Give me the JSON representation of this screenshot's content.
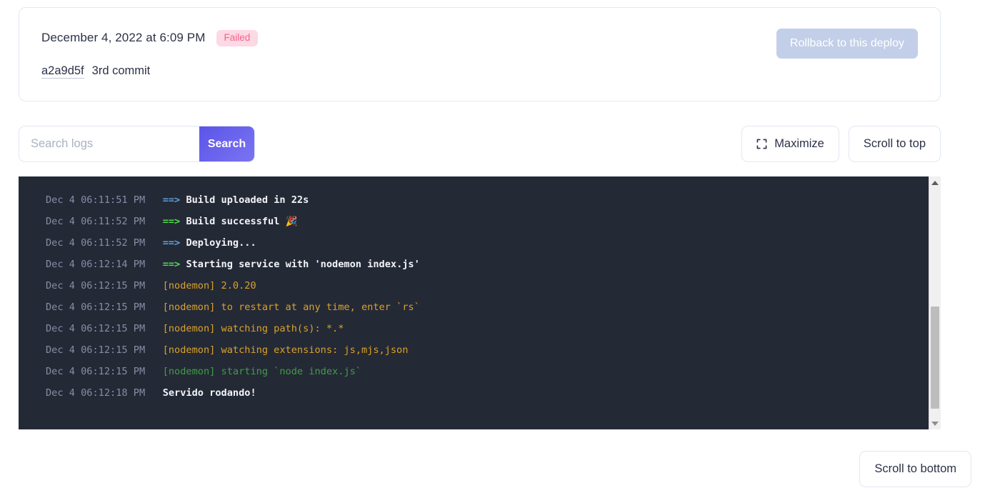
{
  "deploy": {
    "date": "December 4, 2022 at 6:09 PM",
    "status": "Failed",
    "status_bg": "#fcd9e4",
    "status_fg": "#f4648c",
    "commit_hash": "a2a9d5f",
    "commit_message": "3rd commit",
    "rollback_label": "Rollback to this deploy"
  },
  "toolbar": {
    "search_placeholder": "Search logs",
    "search_value": "",
    "search_label": "Search",
    "search_accent": "#5b55e8",
    "maximize_label": "Maximize",
    "maximize_icon": "expand-corners-icon",
    "scroll_top_label": "Scroll to top"
  },
  "console": {
    "background": "#242936",
    "lines": [
      {
        "time": "Dec 4 06:11:51 PM",
        "prefix": "==>",
        "prefix_color": "blue",
        "text": "Build uploaded in 22s",
        "text_color": "white"
      },
      {
        "time": "Dec 4 06:11:52 PM",
        "prefix": "==>",
        "prefix_color": "green",
        "text": "Build successful 🎉",
        "text_color": "white"
      },
      {
        "time": "Dec 4 06:11:52 PM",
        "prefix": "==>",
        "prefix_color": "blue",
        "text": "Deploying...",
        "text_color": "white"
      },
      {
        "time": "Dec 4 06:12:14 PM",
        "prefix": "==>",
        "prefix_color": "green",
        "text": "Starting service with 'nodemon index.js'",
        "text_color": "white"
      },
      {
        "time": "Dec 4 06:12:15 PM",
        "prefix": "",
        "prefix_color": "",
        "text": "[nodemon] 2.0.20",
        "text_color": "amber"
      },
      {
        "time": "Dec 4 06:12:15 PM",
        "prefix": "",
        "prefix_color": "",
        "text": "[nodemon] to restart at any time, enter `rs`",
        "text_color": "amber"
      },
      {
        "time": "Dec 4 06:12:15 PM",
        "prefix": "",
        "prefix_color": "",
        "text": "[nodemon] watching path(s): *.*",
        "text_color": "amber"
      },
      {
        "time": "Dec 4 06:12:15 PM",
        "prefix": "",
        "prefix_color": "",
        "text": "[nodemon] watching extensions: js,mjs,json",
        "text_color": "amber"
      },
      {
        "time": "Dec 4 06:12:15 PM",
        "prefix": "",
        "prefix_color": "",
        "text": "[nodemon] starting `node index.js`",
        "text_color": "green2"
      },
      {
        "time": "Dec 4 06:12:18 PM",
        "prefix": "",
        "prefix_color": "",
        "text": "Servido rodando!",
        "text_color": "white"
      }
    ]
  },
  "scrollbar": {
    "up_arrow": "triangle-up-icon",
    "down_arrow": "triangle-down-icon"
  },
  "footer": {
    "scroll_bottom_label": "Scroll to bottom"
  }
}
